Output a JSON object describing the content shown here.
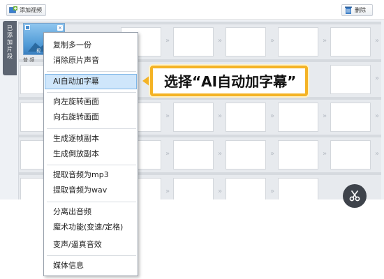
{
  "toolbar": {
    "add_video_label": "添加视频",
    "add_video_icon": "add-video-icon",
    "delete_label": "删除",
    "delete_icon": "trash-icon"
  },
  "sidebar_tab": {
    "label": "已添加片段"
  },
  "clip": {
    "thumb_label": "视",
    "sub_label": "普 频"
  },
  "context_menu": {
    "items": [
      "复制多一份",
      "消除原片声音",
      "AI自动加字幕",
      "向左旋转画面",
      "向右旋转画面",
      "生成逐帧副本",
      "生成倒放副本",
      "提取音频为mp3",
      "提取音频为wav",
      "分离出音频",
      "魔术功能(变速/定格)",
      "变声/逼真音效",
      "媒体信息"
    ],
    "highlighted": "AI自动加字幕"
  },
  "callout": {
    "text": "选择“AI自动加字幕”",
    "accent_color": "#f4b325"
  },
  "scissors": {
    "icon": "scissors-icon"
  }
}
